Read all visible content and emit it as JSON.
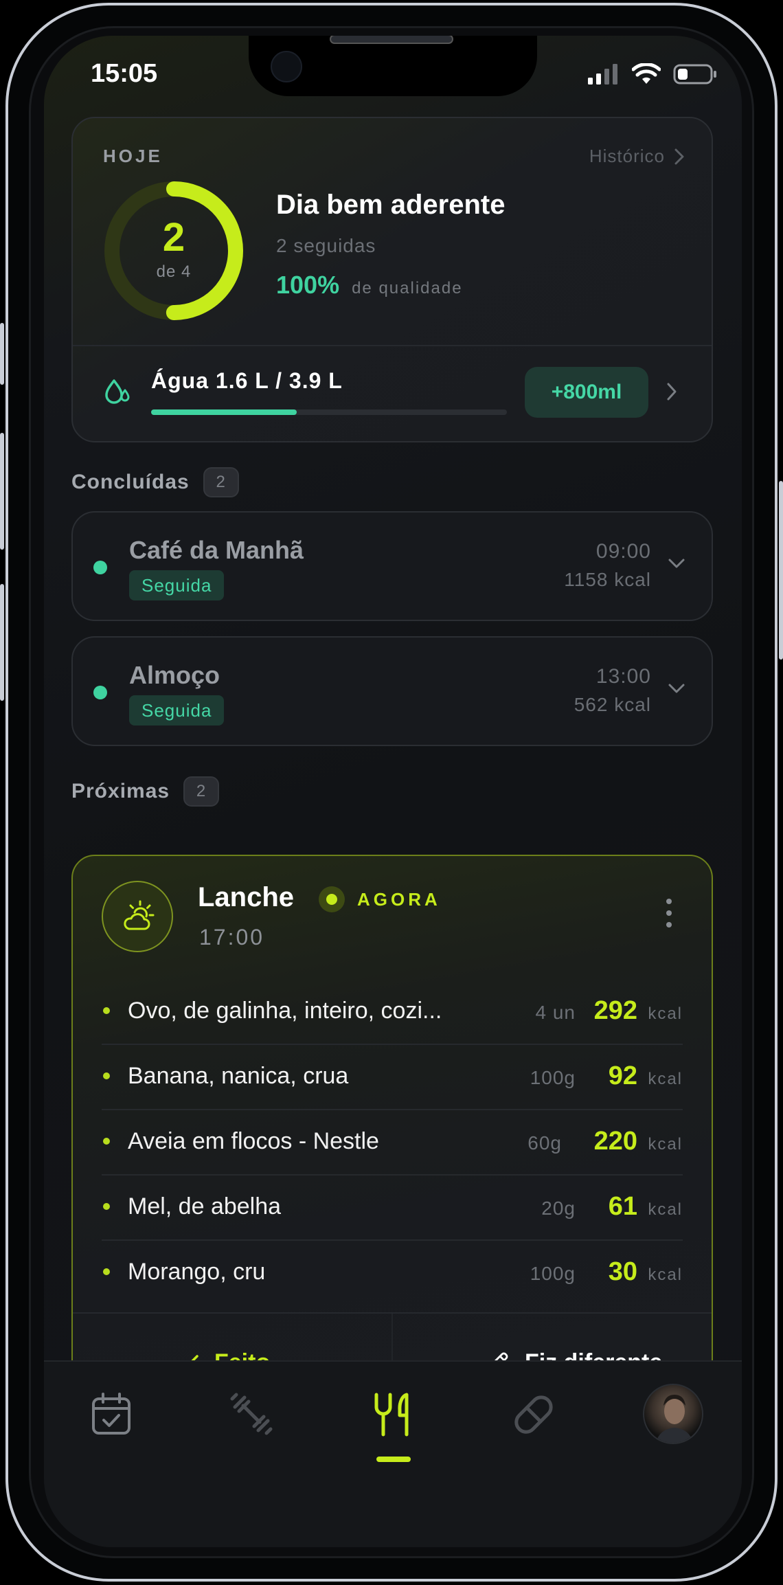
{
  "status_bar": {
    "time": "15:05"
  },
  "today": {
    "label": "HOJE",
    "history_link": "Histórico",
    "ring": {
      "done": "2",
      "total_label": "de 4",
      "progress": 0.5
    },
    "title": "Dia bem aderente",
    "streak": "2 seguidas",
    "quality_value": "100%",
    "quality_label": "de qualidade",
    "water": {
      "label": "Água 1.6 L / 3.9 L",
      "progress": 0.41,
      "add_button": "+800ml"
    }
  },
  "completed": {
    "title": "Concluídas",
    "count": "2",
    "meals": [
      {
        "name": "Café da Manhã",
        "status": "Seguida",
        "time": "09:00",
        "kcal": "1158 kcal"
      },
      {
        "name": "Almoço",
        "status": "Seguida",
        "time": "13:00",
        "kcal": "562 kcal"
      }
    ]
  },
  "upcoming": {
    "title": "Próximas",
    "count": "2",
    "meal": {
      "name": "Lanche",
      "time": "17:00",
      "now_label": "AGORA",
      "foods": [
        {
          "name": "Ovo, de galinha, inteiro, cozi...",
          "qty": "4 un",
          "kcal": "292",
          "unit": "kcal"
        },
        {
          "name": "Banana, nanica, crua",
          "qty": "100g",
          "kcal": "92",
          "unit": "kcal"
        },
        {
          "name": "Aveia em flocos - Nestle",
          "qty": "60g",
          "kcal": "220",
          "unit": "kcal"
        },
        {
          "name": "Mel, de abelha",
          "qty": "20g",
          "kcal": "61",
          "unit": "kcal"
        },
        {
          "name": "Morango, cru",
          "qty": "100g",
          "kcal": "30",
          "unit": "kcal"
        }
      ],
      "done_button": "Feito",
      "different_button": "Fiz diferente"
    }
  },
  "tabbar": {
    "items": [
      "calendar-icon",
      "dumbbell-icon",
      "fork-knife-icon",
      "pill-icon",
      "avatar"
    ],
    "active": "fork-knife-icon"
  },
  "colors": {
    "accent": "#c6ec1b",
    "success": "#3fd3a0",
    "background": "#111316"
  }
}
